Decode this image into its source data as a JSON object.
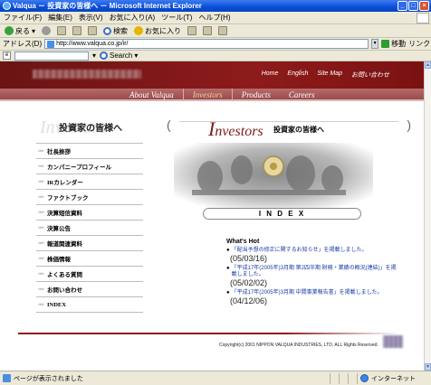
{
  "window": {
    "title": "Valqua － 投資家の皆様へ － Microsoft Internet Explorer",
    "controls": [
      "minimize",
      "maximize",
      "close"
    ]
  },
  "menubar": {
    "items": [
      "ファイル(F)",
      "編集(E)",
      "表示(V)",
      "お気に入り(A)",
      "ツール(T)",
      "ヘルプ(H)"
    ]
  },
  "toolbar": {
    "back_label": "戻る",
    "search_label": "検索",
    "favorites_label": "お気に入り"
  },
  "addressbar": {
    "label": "アドレス(D)",
    "url": "http://www.valqua.co.jp/ir/",
    "go_label": "移動",
    "links_label": "リンク"
  },
  "linksbar": {
    "search_label": "Search"
  },
  "site": {
    "top_nav": [
      "Home",
      "English",
      "Site Map",
      "お問い合わせ"
    ],
    "main_nav": [
      "About Valqua",
      "Investors",
      "Products",
      "Careers"
    ],
    "main_nav_active": "Investors",
    "left_heading_ghost": "Investors",
    "left_heading": "投資家の皆様へ",
    "side_menu": [
      "社長挨拶",
      "カンパニープロフィール",
      "IRカレンダー",
      "ファクトブック",
      "決算短信資料",
      "決算公告",
      "報道関連資料",
      "株価情報",
      "よくある質問",
      "お問い合わせ",
      "INDEX"
    ],
    "side_bullet": "»»»",
    "investors_heading_en_cap": "I",
    "investors_heading_en_rest": "nvestors",
    "investors_heading_jp": "投資家の皆様へ",
    "bracket_left": "(",
    "bracket_right": ")",
    "index_label": "I N D E X",
    "whats_hot_title": "What's Hot",
    "news": [
      {
        "text": "「配当予想の修正に関するお知らせ」を掲載しました。",
        "date": "(05/03/16)"
      },
      {
        "text": "「平成17年(2005年)3月期 第2四半期 財務・業績の概況(連結)」を掲載しました。",
        "date": "(05/02/02)"
      },
      {
        "text": "「平成17年(2005年)3月期 中間事業報告書」を掲載しました。",
        "date": "(04/12/06)"
      }
    ],
    "news_bullet": "●",
    "copyright": "Copyright(c) 2001 NIPPON VALQUA INDUSTRIES, LTD. ALL Rights Reserved."
  },
  "statusbar": {
    "text": "ページが表示されました",
    "zone": "インターネット"
  },
  "colors": {
    "brand": "#8e1b1b",
    "nav": "#b56b6b",
    "link": "#1a3aa8"
  }
}
